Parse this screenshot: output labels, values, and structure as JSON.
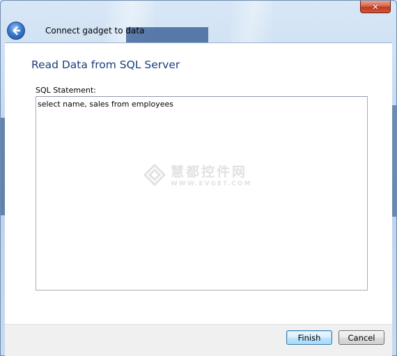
{
  "window": {
    "title": "Connect gadget to data",
    "close_glyph": "✕"
  },
  "page": {
    "heading": "Read Data from SQL Server",
    "sql_label": "SQL Statement:",
    "sql_value": "select name, sales from employees"
  },
  "watermark": {
    "chinese": "慧都控件网",
    "english": "WWW.EVGET.COM"
  },
  "buttons": {
    "finish": "Finish",
    "cancel": "Cancel"
  },
  "colors": {
    "heading": "#1b3d7a",
    "close": "#c1381d",
    "back_arrow": "#3b7ad0"
  }
}
